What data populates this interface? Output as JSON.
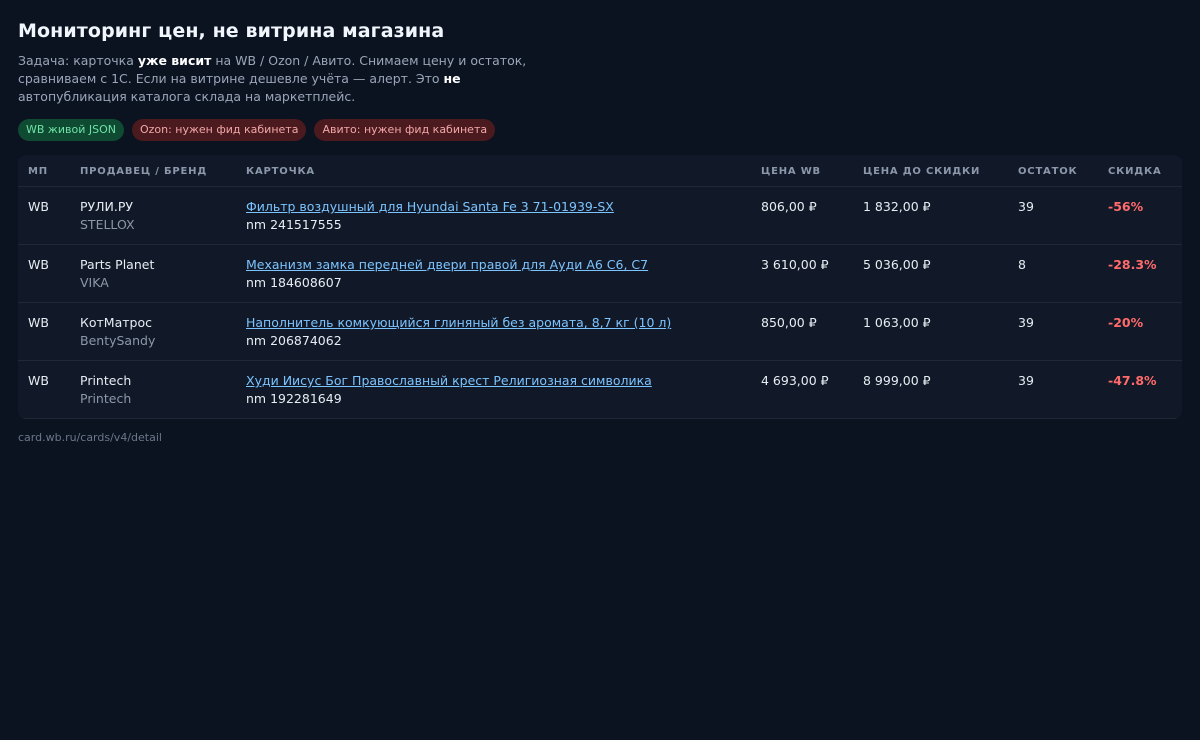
{
  "header": {
    "title": "Мониторинг цен, не витрина магазина",
    "desc_p1": "Задача: карточка ",
    "desc_b1": "уже висит",
    "desc_p2": " на WB / Ozon / Авито. Снимаем цену и остаток, сравниваем с 1С. Если на витрине дешевле учёта — алерт. Это ",
    "desc_b2": "не",
    "desc_p3": " автопубликация каталога склада на маркетплейс."
  },
  "badges": [
    {
      "label": "WB живой JSON",
      "status": "ok",
      "color": "#6fe3a6"
    },
    {
      "label": "Ozon: нужен фид кабинета",
      "status": "bad",
      "color": "#f2a7a7"
    },
    {
      "label": "Авито: нужен фид кабинета",
      "status": "bad",
      "color": "#f2a7a7"
    }
  ],
  "table": {
    "columns": [
      "МП",
      "ПРОДАВЕЦ / БРЕНД",
      "КАРТОЧКА",
      "ЦЕНА WB",
      "ЦЕНА ДО СКИДКИ",
      "ОСТАТОК",
      "СКИДКА"
    ],
    "rows": [
      {
        "mp": "WB",
        "seller": "РУЛИ.РУ",
        "brand": "STELLOX",
        "title": "Фильтр воздушный для Hyundai Santa Fe 3 71-01939-SX",
        "nm": "nm 241517555",
        "price": "806,00 ₽",
        "old_price": "1 832,00 ₽",
        "stock": "39",
        "discount": "-56%"
      },
      {
        "mp": "WB",
        "seller": "Parts Planet",
        "brand": "VIKA",
        "title": "Механизм замка передней двери правой для Ауди А6 С6, С7",
        "nm": "nm 184608607",
        "price": "3 610,00 ₽",
        "old_price": "5 036,00 ₽",
        "stock": "8",
        "discount": "-28.3%"
      },
      {
        "mp": "WB",
        "seller": "КотМатрос",
        "brand": "BentySandy",
        "title": "Наполнитель комкующийся глиняный без аромата, 8,7 кг (10 л)",
        "nm": "nm 206874062",
        "price": "850,00 ₽",
        "old_price": "1 063,00 ₽",
        "stock": "39",
        "discount": "-20%"
      },
      {
        "mp": "WB",
        "seller": "Printech",
        "brand": "Printech",
        "title": "Худи Иисус Бог Православный крест Религиозная символика",
        "nm": "nm 192281649",
        "price": "4 693,00 ₽",
        "old_price": "8 999,00 ₽",
        "stock": "39",
        "discount": "-47.8%"
      }
    ]
  },
  "footer": {
    "source": "card.wb.ru/cards/v4/detail"
  },
  "colors": {
    "background": "#0b1220",
    "link": "#7cc4ff",
    "discount": "#ff6b6b"
  }
}
